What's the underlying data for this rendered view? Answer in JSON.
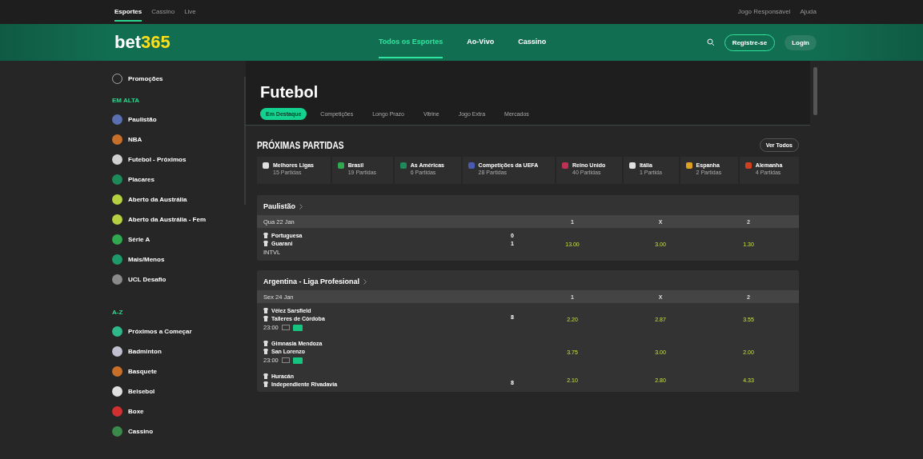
{
  "top_bar": {
    "links": [
      {
        "label": "Esportes",
        "selected": true
      },
      {
        "label": "Cassino",
        "selected": false
      },
      {
        "label": "Live",
        "selected": false
      }
    ],
    "right_links": [
      "Jogo Responsável",
      "Ajuda"
    ]
  },
  "header": {
    "logo_main": "bet",
    "logo_accent": "365",
    "nav": [
      {
        "label": "Todos os Esportes",
        "selected": true
      },
      {
        "label": "Ao-Vivo",
        "selected": false
      },
      {
        "label": "Cassino",
        "selected": false
      }
    ],
    "register": "Registre-se",
    "login": "Login"
  },
  "sidebar": {
    "promo": "Promoções",
    "sections": [
      {
        "title": "EM ALTA",
        "items": [
          {
            "label": "Paulistão",
            "color": "#5a6fb0"
          },
          {
            "label": "NBA",
            "color": "#c8702a"
          },
          {
            "label": "Futebol - Próximos",
            "color": "#d0d0d0"
          },
          {
            "label": "Placares",
            "color": "#1e8a5a"
          },
          {
            "label": "Aberto da Austrália",
            "color": "#b5d040"
          },
          {
            "label": "Aberto da Austrália - Fem",
            "color": "#b5d040"
          },
          {
            "label": "Série A",
            "color": "#2fa84f"
          },
          {
            "label": "Mais/Menos",
            "color": "#1e9a6a"
          },
          {
            "label": "UCL Desafio",
            "color": "#8a8a8a"
          }
        ]
      },
      {
        "title": "A-Z",
        "items": [
          {
            "label": "Próximos a Começar",
            "color": "#2fb88a"
          },
          {
            "label": "Badminton",
            "color": "#c0c0d0"
          },
          {
            "label": "Basquete",
            "color": "#c8702a"
          },
          {
            "label": "Beisebol",
            "color": "#e0e0e0"
          },
          {
            "label": "Boxe",
            "color": "#d03030"
          },
          {
            "label": "Cassino",
            "color": "#3a8a4a"
          }
        ]
      }
    ]
  },
  "main": {
    "title": "Futebol",
    "tabs": [
      {
        "label": "Em Destaque",
        "selected": true
      },
      {
        "label": "Competições",
        "selected": false
      },
      {
        "label": "Longo Prazo",
        "selected": false
      },
      {
        "label": "Vitrine",
        "selected": false
      },
      {
        "label": "Jogo Extra",
        "selected": false
      },
      {
        "label": "Mercados",
        "selected": false
      }
    ],
    "upcoming": {
      "title": "PRÓXIMAS PARTIDAS",
      "see_all": "Ver Todos",
      "chips": [
        {
          "label": "Melhores Ligas",
          "count": "15 Partidas",
          "color": "#e0e0e0"
        },
        {
          "label": "Brasil",
          "count": "19 Partidas",
          "color": "#2fa84f"
        },
        {
          "label": "As Américas",
          "count": "6 Partidas",
          "color": "#1e8a5a"
        },
        {
          "label": "Competições da UEFA",
          "count": "28 Partidas",
          "color": "#4a5ab0"
        },
        {
          "label": "Reino Unido",
          "count": "40 Partidas",
          "color": "#c03050"
        },
        {
          "label": "Itália",
          "count": "1 Partida",
          "color": "#e0e0e0"
        },
        {
          "label": "Espanha",
          "count": "2 Partidas",
          "color": "#e0a020"
        },
        {
          "label": "Alemanha",
          "count": "4 Partidas",
          "color": "#d04020"
        }
      ]
    },
    "competitions": [
      {
        "name": "Paulistão",
        "date": "Qua 22 Jan",
        "columns": [
          "1",
          "X",
          "2"
        ],
        "matches": [
          {
            "teams": [
              "Portuguesa",
              "Guarani"
            ],
            "scores": [
              "0",
              "1"
            ],
            "status": "INTVL",
            "odds": [
              "13.00",
              "3.00",
              "1.30"
            ]
          }
        ]
      },
      {
        "name": "Argentina - Liga Profesional",
        "date": "Sex 24 Jan",
        "columns": [
          "1",
          "X",
          "2"
        ],
        "matches": [
          {
            "teams": [
              "Vélez Sarsfield",
              "Talleres de Córdoba"
            ],
            "time": "23:00",
            "count": "8",
            "odds": [
              "2.20",
              "2.87",
              "3.55"
            ]
          },
          {
            "teams": [
              "Gimnasia Mendoza",
              "San Lorenzo"
            ],
            "time": "23:00",
            "odds": [
              "3.75",
              "3.00",
              "2.00"
            ]
          },
          {
            "teams": [
              "Huracán",
              "Independiente Rivadavia"
            ],
            "count": "8",
            "odds": [
              "2.10",
              "2.80",
              "4.33"
            ]
          }
        ]
      }
    ]
  }
}
